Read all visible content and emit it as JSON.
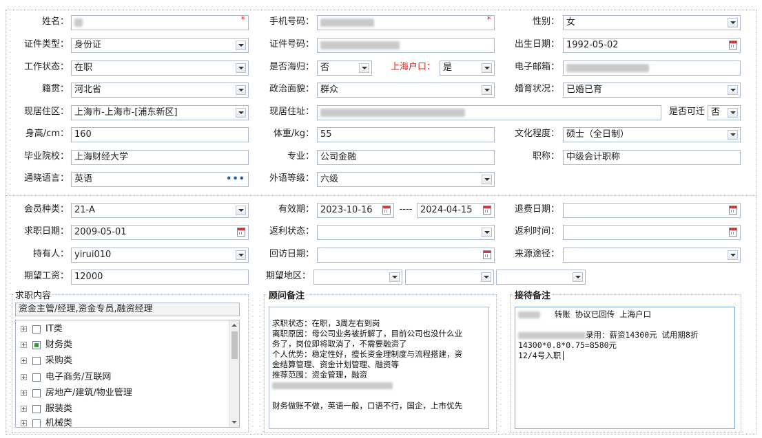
{
  "basic": {
    "name": {
      "label": "姓名：",
      "required": "*"
    },
    "phone": {
      "label": "手机号码：",
      "required": "*"
    },
    "gender": {
      "label": "性别：",
      "value": "女"
    },
    "id_type": {
      "label": "证件类型：",
      "value": "身份证"
    },
    "id_no": {
      "label": "证件号码："
    },
    "birth": {
      "label": "出生日期：",
      "value": "1992-05-02"
    },
    "work_status": {
      "label": "工作状态：",
      "value": "在职"
    },
    "returnee": {
      "label": "是否海归：",
      "value": "否"
    },
    "sh_hukou": {
      "label": "上海户口：",
      "value": "是"
    },
    "email": {
      "label": "电子邮箱："
    },
    "native": {
      "label": "籍贯：",
      "value": "河北省"
    },
    "politics": {
      "label": "政治面貌：",
      "value": "群众"
    },
    "marital": {
      "label": "婚育状况：",
      "value": "已婚已育"
    },
    "residence": {
      "label": "现居住区：",
      "value": "上海市-上海市-[浦东新区]"
    },
    "address": {
      "label": "现居住址："
    },
    "relocate": {
      "label": "是否可迁",
      "value": "否"
    },
    "height": {
      "label": "身高/cm：",
      "value": "160"
    },
    "weight": {
      "label": "体重/kg：",
      "value": "55"
    },
    "education": {
      "label": "文化程度：",
      "value": "硕士（全日制）"
    },
    "school": {
      "label": "毕业院校：",
      "value": "上海财经大学"
    },
    "major": {
      "label": "专业：",
      "value": "公司金融"
    },
    "title": {
      "label": "职称：",
      "value": "中级会计职称"
    },
    "language": {
      "label": "通晓语言：",
      "value": "英语",
      "more": "•••"
    },
    "lang_level": {
      "label": "外语等级：",
      "value": "六级"
    }
  },
  "membership": {
    "member_type": {
      "label": "会员种类：",
      "value": "21-A"
    },
    "valid": {
      "label": "有效期：",
      "from": "2023-10-16",
      "sep": "----",
      "to": "2024-04-15"
    },
    "refund_date": {
      "label": "退费日期："
    },
    "job_date": {
      "label": "求职日期：",
      "value": "2009-05-01"
    },
    "rebate_status": {
      "label": "返利状态："
    },
    "rebate_time": {
      "label": "返利时间："
    },
    "holder": {
      "label": "持有人：",
      "value": "yirui010"
    },
    "visit_date": {
      "label": "回访日期："
    },
    "source": {
      "label": "来源途径："
    },
    "salary": {
      "label": "期望工资：",
      "value": "12000"
    },
    "region": {
      "label": "期望地区："
    }
  },
  "job_content": {
    "title": "求职内容",
    "summary": "资金主管/经理,资金专员,融资经理",
    "categories": [
      {
        "label": "IT类",
        "partial": false
      },
      {
        "label": "财务类",
        "partial": true
      },
      {
        "label": "采购类",
        "partial": false
      },
      {
        "label": "电子商务/互联网",
        "partial": false
      },
      {
        "label": "房地产/建筑/物业管理",
        "partial": false
      },
      {
        "label": "服装类",
        "partial": false
      },
      {
        "label": "机械类",
        "partial": false
      }
    ]
  },
  "consultant_note": {
    "title": "顾问备注",
    "lines": [
      "求职状态：在职，3周左右到岗",
      "离职原因：母公司业务被折解了，目前公司也没什么业",
      "务了，岗位即将取消了，不需要融资了",
      "个人优势：稳定性好，擅长资金理制度与流程搭建，资",
      "金结算管理、资金计划管理、融资等",
      "推荐范围：资金管理，融资",
      "",
      "",
      "财务做账不做，英语一般，口语不行，国企，上市优先"
    ]
  },
  "reception_note": {
    "title": "接待备注",
    "line1": "转账 协议已回传   上海户口",
    "line2": "录用：薪资14300元 试用期8折",
    "line3": "14300*0.8*0.75=8580元",
    "line4": "12/4号入职"
  },
  "colors": {
    "border": "#a9b8c8",
    "required": "#e0241b",
    "check_green": "#2f9e3c",
    "frame": "#9fb6cf"
  }
}
